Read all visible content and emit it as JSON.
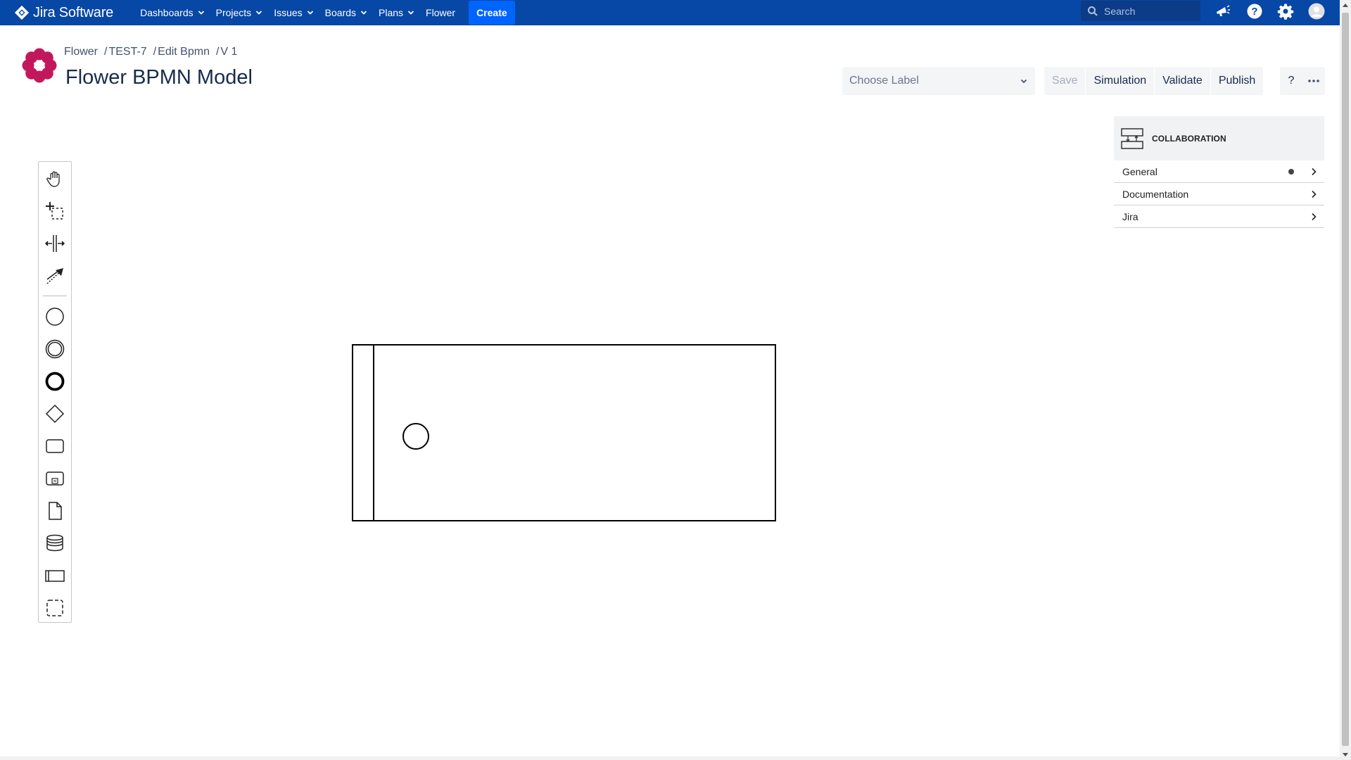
{
  "topnav": {
    "brand": "Jira Software",
    "items": [
      {
        "label": "Dashboards",
        "dropdown": true
      },
      {
        "label": "Projects",
        "dropdown": true
      },
      {
        "label": "Issues",
        "dropdown": true
      },
      {
        "label": "Boards",
        "dropdown": true
      },
      {
        "label": "Plans",
        "dropdown": true
      },
      {
        "label": "Flower",
        "dropdown": false
      }
    ],
    "create_label": "Create",
    "search_placeholder": "Search",
    "icons": [
      "notifications-icon",
      "help-icon",
      "settings-icon",
      "profile-avatar-icon"
    ]
  },
  "header": {
    "breadcrumb": [
      "Flower",
      "TEST-7",
      "Edit Bpmn",
      "V 1"
    ],
    "title": "Flower BPMN Model"
  },
  "toolbar": {
    "label_placeholder": "Choose Label",
    "save_label": "Save",
    "simulation_label": "Simulation",
    "validate_label": "Validate",
    "publish_label": "Publish",
    "help_label": "?"
  },
  "palette": {
    "tools": [
      "hand-tool-icon",
      "lasso-tool-icon",
      "space-tool-icon",
      "global-connect-tool-icon",
      "start-event-icon",
      "intermediate-event-icon",
      "end-event-icon",
      "gateway-icon",
      "task-icon",
      "subprocess-icon",
      "data-object-icon",
      "data-store-icon",
      "pool-participant-icon",
      "group-icon"
    ]
  },
  "properties_panel": {
    "element_type": "COLLABORATION",
    "groups": [
      {
        "label": "General",
        "has_indicator": true
      },
      {
        "label": "Documentation",
        "has_indicator": false
      },
      {
        "label": "Jira",
        "has_indicator": false
      }
    ]
  },
  "colors": {
    "nav_bg": "#0747a6",
    "create_bg": "#0065ff",
    "logo": "#c2185b"
  }
}
